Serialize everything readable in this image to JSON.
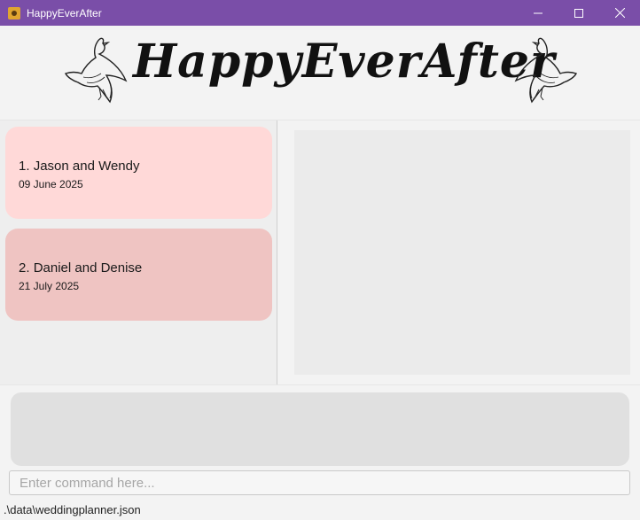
{
  "window": {
    "title": "HappyEverAfter",
    "icon": "app-icon",
    "controls": [
      "minimize-icon",
      "maximize-icon",
      "close-icon"
    ]
  },
  "banner": {
    "title": "HappyEverAfter",
    "decorations": [
      "dove-icon",
      "dove-icon"
    ]
  },
  "weddings": [
    {
      "index": "1.",
      "name": "Jason and Wendy",
      "date": "09 June 2025",
      "color": "#ffd9d8"
    },
    {
      "index": "2.",
      "name": "Daniel and Denise",
      "date": "21 July 2025",
      "color": "#efc4c2"
    }
  ],
  "command": {
    "placeholder": "Enter command here...",
    "value": ""
  },
  "status": {
    "path": ".\\data\\weddingplanner.json"
  },
  "colors": {
    "titlebar": "#7a4ea8",
    "background": "#f3f3f3",
    "result_box": "#e0e0e0"
  }
}
